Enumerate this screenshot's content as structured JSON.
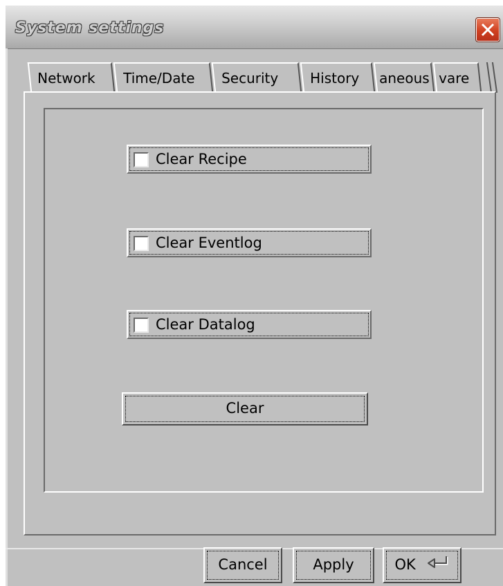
{
  "window": {
    "title": "System settings"
  },
  "tabs": [
    {
      "label": "Network",
      "active": false
    },
    {
      "label": "Time/Date",
      "active": false
    },
    {
      "label": "Security",
      "active": false
    },
    {
      "label": "History",
      "active": true
    },
    {
      "label": "aneous",
      "active": false
    },
    {
      "label": "vare",
      "active": false
    }
  ],
  "history": {
    "checkboxes": [
      {
        "label": "Clear Recipe",
        "checked": false
      },
      {
        "label": "Clear Eventlog",
        "checked": false
      },
      {
        "label": "Clear Datalog",
        "checked": false
      }
    ],
    "clear_label": "Clear"
  },
  "footer": {
    "cancel_label": "Cancel",
    "apply_label": "Apply",
    "ok_label": "OK"
  },
  "icons": {
    "close": "close-icon",
    "ok": "enter-return-icon"
  },
  "colors": {
    "dialog_bg": "#c0c0c0",
    "close_button": "#d04020"
  }
}
